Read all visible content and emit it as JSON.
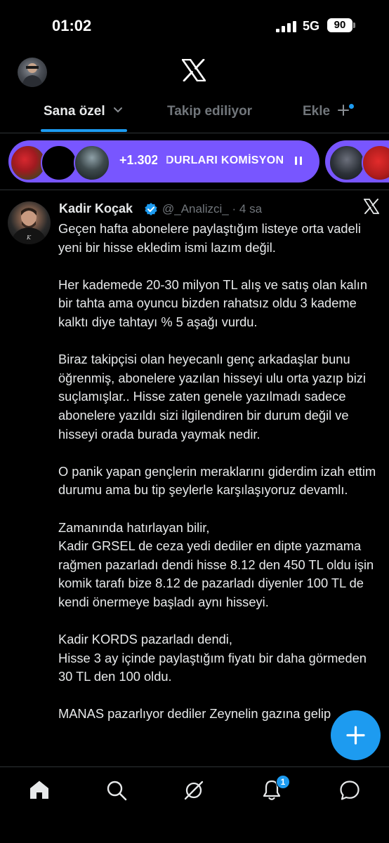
{
  "status_bar": {
    "time": "01:02",
    "network": "5G",
    "battery": "90"
  },
  "tabs": [
    {
      "label": "Sana özel"
    },
    {
      "label": "Takip ediliyor"
    },
    {
      "label": "Ekle"
    }
  ],
  "spaces": {
    "listener_count": "+1.302",
    "title_partial": "DURLARI KOMİSYON"
  },
  "tweet": {
    "author_name": "Kadir Koçak",
    "author_handle": "@_Analizci_",
    "separator": "·",
    "time_ago": "4 sa",
    "paragraphs": [
      "Geçen hafta abonelere paylaştığım listeye orta vadeli yeni bir hisse ekledim ismi lazım değil.",
      "Her kademede 20-30 milyon TL alış ve satış olan kalın bir tahta ama oyuncu bizden rahatsız oldu 3 kademe kalktı diye tahtayı % 5 aşağı vurdu.",
      "Biraz takipçisi olan heyecanlı genç arkadaşlar bunu öğrenmiş, abonelere yazılan hisseyi ulu orta yazıp bizi suçlamışlar.. Hisse zaten genele yazılmadı sadece abonelere yazıldı sizi ilgilendiren bir durum değil ve hisseyi orada burada yaymak nedir.",
      "O panik yapan gençlerin meraklarını giderdim izah ettim durumu ama bu tip şeylerle karşılaşıyoruz devamlı.",
      "Zamanında hatırlayan bilir,\nKadir GRSEL de ceza yedi dediler en dipte yazmama rağmen pazarladı dendi hisse 8.12 den 450 TL oldu işin komik tarafı bize 8.12 de pazarladı diyenler 100 TL de kendi önermeye başladı aynı hisseyi.",
      "Kadir KORDS pazarladı dendi,\nHisse 3 ay içinde paylaştığım fiyatı bir daha görmeden 30 TL den 100 oldu.",
      "MANAS pazarlıyor dediler Zeynelin gazına gelip"
    ]
  },
  "notifications_badge": "1",
  "colors": {
    "accent": "#1d9bf0",
    "spaces": "#7856ff",
    "background": "#000000"
  }
}
